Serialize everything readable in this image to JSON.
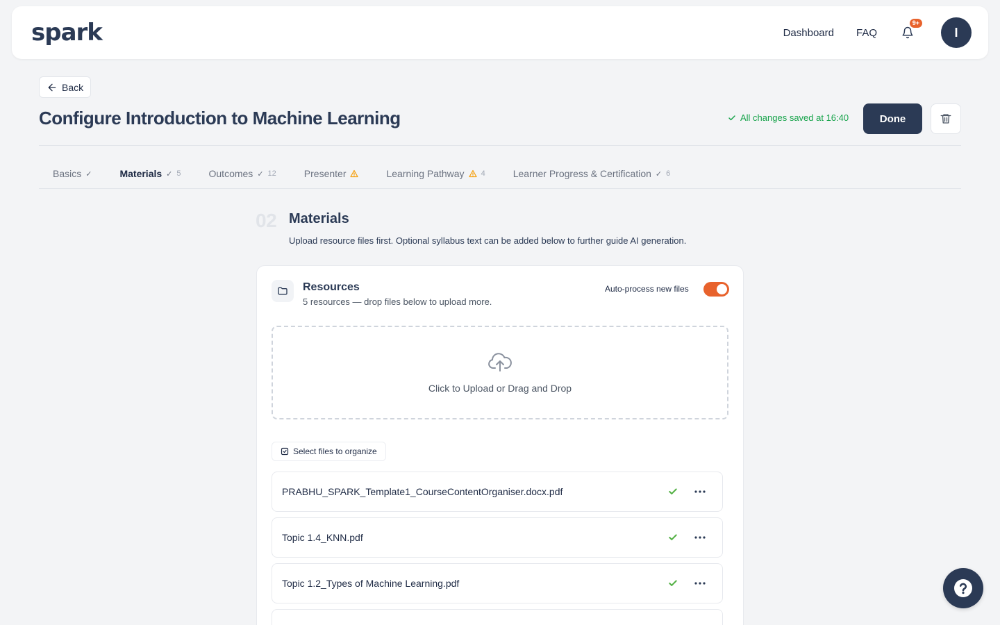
{
  "header": {
    "logo_text": "spark",
    "nav": {
      "dashboard": "Dashboard",
      "faq": "FAQ"
    },
    "notifications_badge": "9+",
    "avatar_initial": "I"
  },
  "page": {
    "back_label": "Back",
    "title": "Configure Introduction to Machine Learning",
    "save_status": "All changes saved at 16:40",
    "done_label": "Done"
  },
  "tabs": [
    {
      "label": "Basics",
      "status": "check",
      "count": ""
    },
    {
      "label": "Materials",
      "status": "check",
      "count": "5"
    },
    {
      "label": "Outcomes",
      "status": "check",
      "count": "12"
    },
    {
      "label": "Presenter",
      "status": "warning",
      "count": ""
    },
    {
      "label": "Learning Pathway",
      "status": "warning",
      "count": "4"
    },
    {
      "label": "Learner Progress & Certification",
      "status": "check",
      "count": "6"
    }
  ],
  "section": {
    "number": "02",
    "title": "Materials",
    "description": "Upload resource files first. Optional syllabus text can be added below to further guide AI generation."
  },
  "resources": {
    "title": "Resources",
    "subtitle": "5 resources — drop files below to upload more.",
    "auto_process_label": "Auto-process new files",
    "auto_process_enabled": true,
    "dropzone_text": "Click to Upload or Drag and Drop",
    "select_label": "Select files to organize",
    "files": [
      {
        "name": "PRABHU_SPARK_Template1_CourseContentOrganiser.docx.pdf",
        "status": "processed"
      },
      {
        "name": "Topic 1.4_KNN.pdf",
        "status": "processed"
      },
      {
        "name": "Topic 1.2_Types of Machine Learning.pdf",
        "status": "processed"
      },
      {
        "name": "",
        "status": "processed"
      }
    ]
  },
  "colors": {
    "primary": "#2b3a55",
    "accent": "#e8622c",
    "success": "#16a34a",
    "warning": "#f59e0b"
  }
}
